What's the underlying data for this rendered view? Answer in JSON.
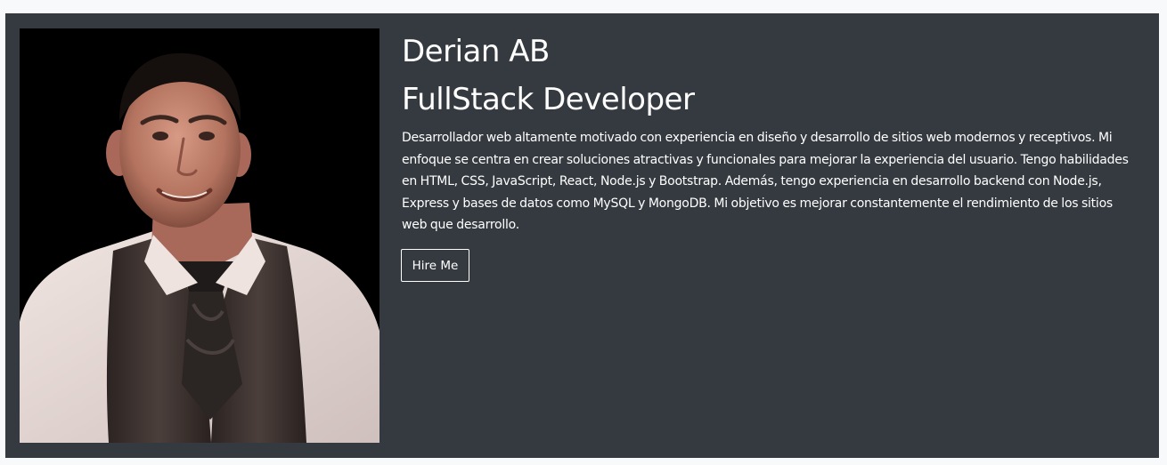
{
  "profile": {
    "name": "Derian AB",
    "role": "FullStack Developer",
    "bio": "Desarrollador web altamente motivado con experiencia en diseño y desarrollo de sitios web modernos y receptivos. Mi enfoque se centra en crear soluciones atractivas y funcionales para mejorar la experiencia del usuario. Tengo habilidades en HTML, CSS, JavaScript, React, Node.js y Bootstrap. Además, tengo experiencia en desarrollo backend con Node.js, Express y bases de datos como MySQL y MongoDB. Mi objetivo es mejorar constantemente el rendimiento de los sitios web que desarrollo.",
    "hire_label": "Hire Me"
  },
  "colors": {
    "page_background": "#f8f9fa",
    "hero_background": "#343a40",
    "text": "#ffffff",
    "photo_background": "#000000"
  }
}
